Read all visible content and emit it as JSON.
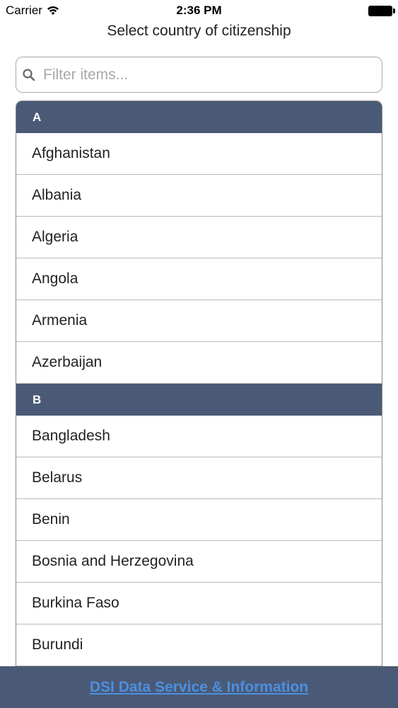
{
  "status_bar": {
    "carrier": "Carrier",
    "time": "2:36 PM"
  },
  "header": {
    "title": "Select country of citizenship"
  },
  "search": {
    "placeholder": "Filter items...",
    "value": ""
  },
  "sections": [
    {
      "letter": "A",
      "items": [
        "Afghanistan",
        "Albania",
        "Algeria",
        "Angola",
        "Armenia",
        "Azerbaijan"
      ]
    },
    {
      "letter": "B",
      "items": [
        "Bangladesh",
        "Belarus",
        "Benin",
        "Bosnia and Herzegovina",
        "Burkina Faso",
        "Burundi"
      ]
    }
  ],
  "footer": {
    "link_label": "DSI Data Service & Information"
  },
  "colors": {
    "header_bar": "#4a5a76",
    "footer_link": "#4d8fe0"
  }
}
